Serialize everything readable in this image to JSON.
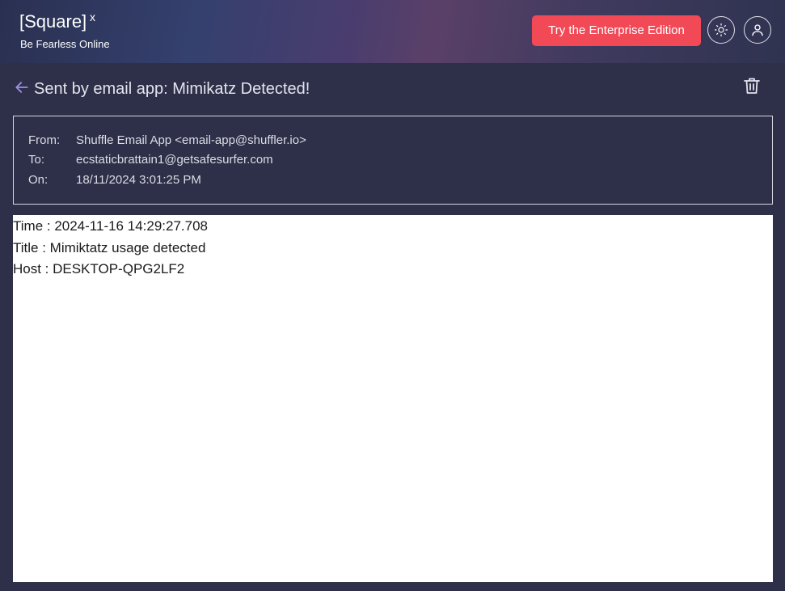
{
  "header": {
    "brand": "[Square]",
    "brand_sup": "x",
    "tagline": "Be Fearless Online",
    "enterprise_label": "Try the Enterprise Edition",
    "theme_icon": "sun-icon",
    "user_icon": "user-icon"
  },
  "email": {
    "subject": "Sent by email app: Mimikatz Detected!",
    "from_label": "From:",
    "from_value": "Shuffle Email App <email-app@shuffler.io>",
    "to_label": "To:",
    "to_value": "ecstaticbrattain1@getsafesurfer.com",
    "on_label": "On:",
    "on_value": "18/11/2024 3:01:25 PM",
    "body_lines": [
      "Time : 2024-11-16 14:29:27.708",
      "Title : Mimiktatz usage detected",
      "Host : DESKTOP-QPG2LF2"
    ]
  },
  "colors": {
    "accent": "#f24957",
    "background": "#2d3048"
  }
}
